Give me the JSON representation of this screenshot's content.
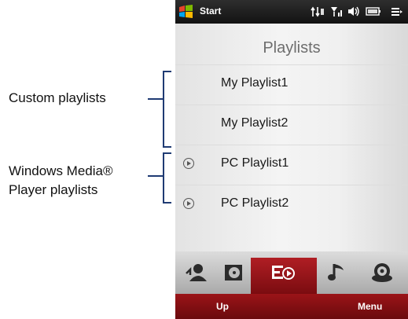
{
  "callouts": {
    "custom": "Custom playlists",
    "wmp_line1": "Windows Media®",
    "wmp_line2": "Player playlists"
  },
  "statusbar": {
    "start_label": "Start",
    "icons": [
      "windows-flag-icon",
      "connectivity-icon",
      "signal-icon",
      "volume-icon",
      "battery-icon",
      "menu-icon"
    ]
  },
  "screen": {
    "title": "Playlists",
    "playlists": [
      {
        "label": "My Playlist1",
        "type": "custom"
      },
      {
        "label": "My Playlist2",
        "type": "custom"
      },
      {
        "label": "PC Playlist1",
        "type": "pc",
        "icon": "play-circle-icon"
      },
      {
        "label": "PC Playlist2",
        "type": "pc",
        "icon": "play-circle-icon"
      }
    ]
  },
  "tabs": [
    {
      "name": "artists-icon",
      "active": false
    },
    {
      "name": "albums-icon",
      "active": false
    },
    {
      "name": "playlists-icon",
      "active": true
    },
    {
      "name": "songs-icon",
      "active": false
    },
    {
      "name": "genres-icon",
      "active": false
    }
  ],
  "softkeys": {
    "left": "Up",
    "right": "Menu"
  },
  "colors": {
    "accent": "#9b1418",
    "bracket": "#1f3b73"
  }
}
